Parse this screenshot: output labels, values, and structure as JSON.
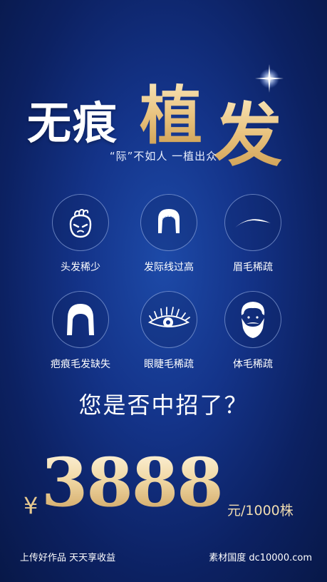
{
  "title": {
    "part1": "无痕",
    "part2_char1": "植",
    "part2_char2": "发"
  },
  "tagline": "“际”不如人 一植出众",
  "icons": [
    {
      "label": "头发稀少",
      "icon": "sparse-hair-face-icon"
    },
    {
      "label": "发际线过高",
      "icon": "high-hairline-icon"
    },
    {
      "label": "眉毛稀疏",
      "icon": "eyebrow-icon"
    },
    {
      "label": "疤痕毛发缺失",
      "icon": "scar-hair-loss-icon"
    },
    {
      "label": "眼睫毛稀疏",
      "icon": "eyelash-icon"
    },
    {
      "label": "体毛稀疏",
      "icon": "beard-icon"
    }
  ],
  "question": "您是否中招了？",
  "price": {
    "currency": "¥",
    "amount": "3888",
    "unit": "元/1000株"
  },
  "footer": {
    "left": "上传好作品 天天享收益",
    "right": "素材国度 dc10000.com"
  },
  "colors": {
    "gold": "#e8c27e",
    "background": "#14348a"
  }
}
